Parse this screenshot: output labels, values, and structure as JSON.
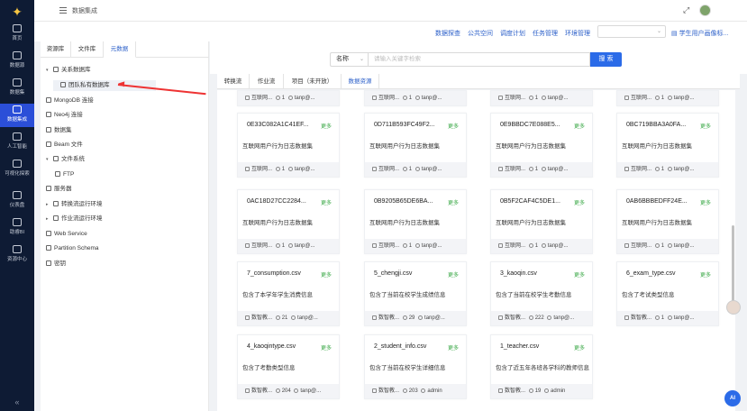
{
  "app": {
    "title": "数据集成"
  },
  "nav": {
    "items": [
      {
        "label": "首页",
        "icon": "home-icon"
      },
      {
        "label": "数据源",
        "icon": "datasource-icon"
      },
      {
        "label": "数据集",
        "icon": "dataset-icon"
      },
      {
        "label": "数据集成",
        "icon": "integration-icon"
      },
      {
        "label": "人工智能",
        "icon": "ai-icon"
      },
      {
        "label": "可视化探索",
        "icon": "chart-icon"
      },
      {
        "label": "仪表盘",
        "icon": "dashboard-icon"
      },
      {
        "label": "助睿BI",
        "icon": "bi-icon"
      },
      {
        "label": "资源中心",
        "icon": "resource-icon"
      }
    ],
    "collapse": "«"
  },
  "header_links": [
    "数据探查",
    "公共空间",
    "调度计划",
    "任务管理",
    "环境管理"
  ],
  "header_user": "学生用户画像标...",
  "panel": {
    "tabs": [
      "资源库",
      "文件库",
      "元数据"
    ],
    "tree": [
      {
        "label": "关系数据库",
        "caret": "▾"
      },
      {
        "label": "团队私有数据库",
        "caret": ""
      },
      {
        "label": "MongoDB 连接",
        "caret": ""
      },
      {
        "label": "Neo4j 连接",
        "caret": ""
      },
      {
        "label": "数据集",
        "caret": ""
      },
      {
        "label": "Beam 文件",
        "caret": ""
      },
      {
        "label": "文件系统",
        "caret": "▾"
      },
      {
        "label": "FTP",
        "caret": ""
      },
      {
        "label": "服务器",
        "caret": ""
      },
      {
        "label": "转换流运行环境",
        "caret": "▸"
      },
      {
        "label": "作业流运行环境",
        "caret": "▸"
      },
      {
        "label": "Web Service",
        "caret": ""
      },
      {
        "label": "Partition Schema",
        "caret": ""
      },
      {
        "label": "密钥",
        "caret": ""
      }
    ]
  },
  "search": {
    "field": "名称",
    "placeholder": "请输入关键字检索",
    "button": "搜 索"
  },
  "content_tabs": [
    "转换流",
    "作业流",
    "项目（未开放）",
    "数据资源"
  ],
  "more_label": "更多",
  "top_row": [
    {
      "source": "互联网...",
      "likes": "1",
      "user": "tanp@..."
    },
    {
      "source": "互联网...",
      "likes": "1",
      "user": "tanp@..."
    },
    {
      "source": "互联网...",
      "likes": "1",
      "user": "tanp@..."
    },
    {
      "source": "互联网...",
      "likes": "1",
      "user": "tanp@..."
    }
  ],
  "cards": [
    {
      "name": "0E33C082A1C41EF...",
      "desc": "互联网用户行为日志数据集",
      "source": "互联网...",
      "likes": "1",
      "user": "tanp@..."
    },
    {
      "name": "0D711B593FC49F2...",
      "desc": "互联网用户行为日志数据集",
      "source": "互联网...",
      "likes": "1",
      "user": "tanp@..."
    },
    {
      "name": "0E9BBDC7E088E5...",
      "desc": "互联网用户行为日志数据集",
      "source": "互联网...",
      "likes": "1",
      "user": "tanp@..."
    },
    {
      "name": "0BC719BBA3A0FA...",
      "desc": "互联网用户行为日志数据集",
      "source": "互联网...",
      "likes": "1",
      "user": "tanp@..."
    },
    {
      "name": "0AC18D27CC2284...",
      "desc": "互联网用户行为日志数据集",
      "source": "互联网...",
      "likes": "1",
      "user": "tanp@..."
    },
    {
      "name": "0B9205B65DE6BA...",
      "desc": "互联网用户行为日志数据集",
      "source": "互联网...",
      "likes": "1",
      "user": "tanp@..."
    },
    {
      "name": "0B5F2CAF4C5DE1...",
      "desc": "互联网用户行为日志数据集",
      "source": "互联网...",
      "likes": "1",
      "user": "tanp@..."
    },
    {
      "name": "0AB6BBBEDFF24E...",
      "desc": "互联网用户行为日志数据集",
      "source": "互联网...",
      "likes": "1",
      "user": "tanp@..."
    },
    {
      "name": "7_consumption.csv",
      "desc": "包含了本学年学生消费信息",
      "source": "数智教...",
      "likes": "21",
      "user": "tanp@..."
    },
    {
      "name": "5_chengji.csv",
      "desc": "包含了当前在校学生成绩信息",
      "source": "数智教...",
      "likes": "29",
      "user": "tanp@..."
    },
    {
      "name": "3_kaoqin.csv",
      "desc": "包含了当前在校学生考勤信息",
      "source": "数智教...",
      "likes": "222",
      "user": "tanp@..."
    },
    {
      "name": "6_exam_type.csv",
      "desc": "包含了考试类型信息",
      "source": "数智教...",
      "likes": "1",
      "user": "tanp@..."
    },
    {
      "name": "4_kaoqintype.csv",
      "desc": "包含了考勤类型信息",
      "source": "数智教...",
      "likes": "204",
      "user": "tanp@..."
    },
    {
      "name": "2_student_info.csv",
      "desc": "包含了当前在校学生详细信息",
      "source": "数智教...",
      "likes": "203",
      "user": "admin"
    },
    {
      "name": "1_teacher.csv",
      "desc": "包含了近五年各班各学科的教师信息",
      "source": "数智教...",
      "likes": "19",
      "user": "admin"
    }
  ],
  "ai_label": "AI"
}
